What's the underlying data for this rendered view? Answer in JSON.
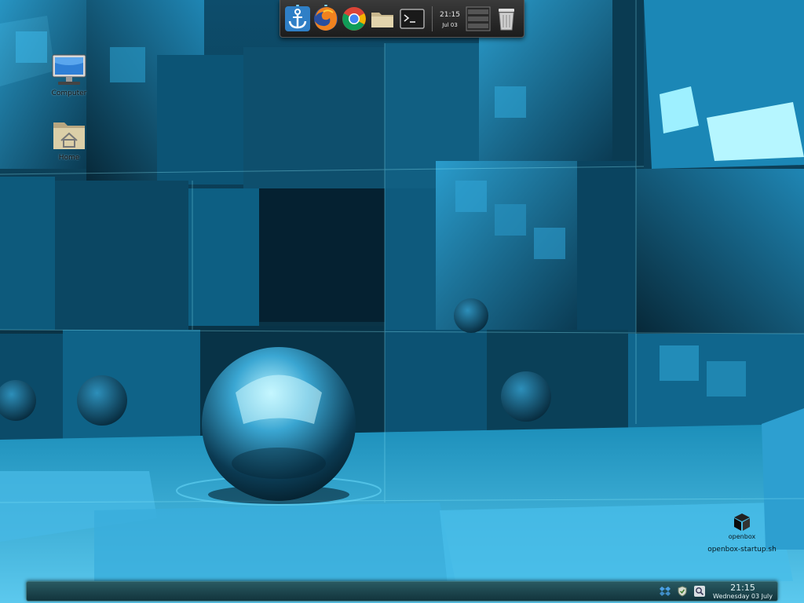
{
  "dock": {
    "items": [
      {
        "name": "anchor-launcher",
        "icon": "anchor-icon"
      },
      {
        "name": "firefox-launcher",
        "icon": "firefox-icon"
      },
      {
        "name": "chrome-launcher",
        "icon": "chrome-icon"
      },
      {
        "name": "file-manager-launcher",
        "icon": "folder-icon"
      },
      {
        "name": "terminal-launcher",
        "icon": "terminal-icon"
      }
    ],
    "clock_time": "21:15",
    "clock_date": "Jul 03",
    "extras": [
      {
        "name": "window-list",
        "icon": "list-icon"
      },
      {
        "name": "trash",
        "icon": "trash-icon"
      }
    ]
  },
  "desktop": {
    "icons": [
      {
        "label": "Computer",
        "icon": "monitor-icon"
      },
      {
        "label": "Home",
        "icon": "home-folder-icon"
      }
    ],
    "startup_script": {
      "logo_text": "openbox",
      "label": "openbox-startup.sh",
      "icon": "openbox-logo-icon"
    }
  },
  "panel": {
    "tray": [
      {
        "name": "dropbox",
        "icon": "dropbox-icon"
      },
      {
        "name": "security",
        "icon": "shield-icon"
      },
      {
        "name": "search",
        "icon": "search-icon"
      }
    ],
    "time": "21:15",
    "date": "Wednesday 03 July"
  },
  "wallpaper": {
    "name": "cube-wallpaper",
    "colors": {
      "dark": "#062433",
      "mid": "#0f5d7e",
      "light": "#3ab8e6",
      "glow": "#8ff0ff"
    }
  }
}
